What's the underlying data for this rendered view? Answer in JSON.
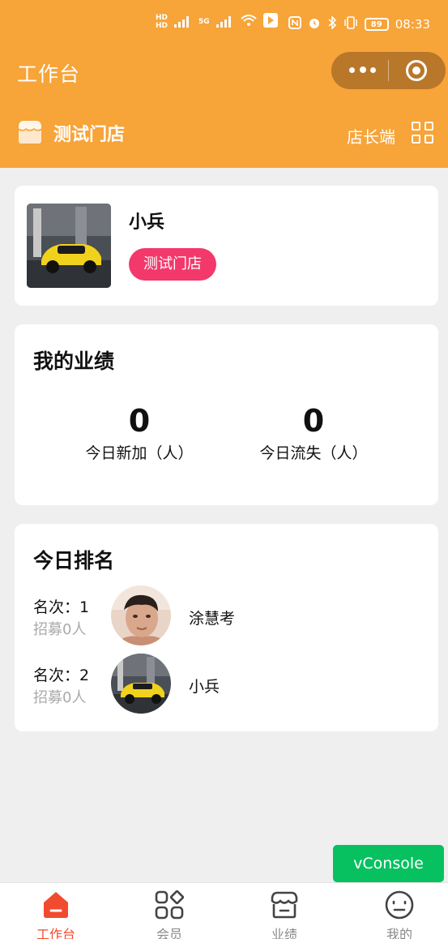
{
  "status_bar": {
    "time": "08:33",
    "battery": "89",
    "network": "5G",
    "hd_labels": [
      "HD",
      "HD"
    ]
  },
  "header": {
    "title": "工作台",
    "store_name": "测试门店",
    "role_switch": "店长端"
  },
  "profile": {
    "name": "小兵",
    "store_badge": "测试门店"
  },
  "performance": {
    "title": "我的业绩",
    "stats": [
      {
        "value": "0",
        "label": "今日新加（人）"
      },
      {
        "value": "0",
        "label": "今日流失（人）"
      }
    ]
  },
  "ranking": {
    "title": "今日排名",
    "items": [
      {
        "rank": "名次：1",
        "recruit": "招募0人",
        "name": "涂慧考"
      },
      {
        "rank": "名次：2",
        "recruit": "招募0人",
        "name": "小兵"
      }
    ]
  },
  "vconsole": {
    "label": "vConsole"
  },
  "tabbar": {
    "items": [
      {
        "label": "工作台",
        "icon": "home-icon",
        "active": true
      },
      {
        "label": "会员",
        "icon": "apps-icon",
        "active": false
      },
      {
        "label": "业绩",
        "icon": "store-icon",
        "active": false
      },
      {
        "label": "我的",
        "icon": "smile-icon",
        "active": false
      }
    ]
  },
  "colors": {
    "header_bg": "#f7a439",
    "badge": "#f3386b",
    "active_tab": "#f24a2e",
    "vconsole": "#07c160"
  }
}
